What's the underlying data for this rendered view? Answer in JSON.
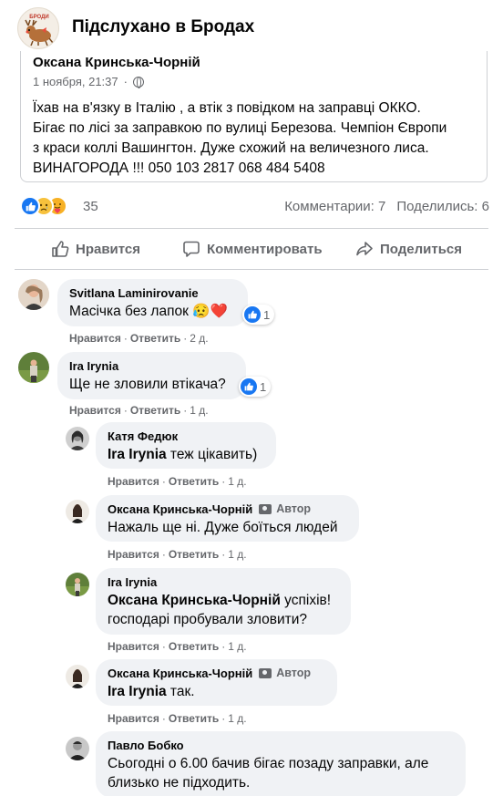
{
  "group": {
    "name": "Підслухано в Бродах",
    "logo_text": "БРОДИ"
  },
  "shared_post": {
    "author": "Оксана Кринська-Чорній",
    "date": "1 ноября, 21:37",
    "date_separator": "·",
    "text_lines": [
      "Їхав на в'язку в Італію , а втік з повідком на заправці ОККО.",
      "Бігає по лісі за заправкою по вулиці Березова. Чемпіон Європи",
      "з краси коллі Вашингтон. Дуже схожий на величезного лиса.",
      "ВИНАГОРОДА !!! 050 103 2817  068 484 5408"
    ]
  },
  "reactions": {
    "count": "35",
    "comments": "Комментарии: 7",
    "shares": "Поделились: 6",
    "icons": [
      "like-icon",
      "sad-icon",
      "care-icon"
    ]
  },
  "actions": {
    "like": "Нравится",
    "comment": "Комментировать",
    "share": "Поделиться"
  },
  "comment_actions": {
    "like": "Нравится",
    "reply": "Ответить",
    "separator": "·"
  },
  "comments": [
    {
      "name": "Svitlana Laminirovanie",
      "text": "Масічка без лапок 😥❤️",
      "time": "2 д.",
      "reactions": "1"
    },
    {
      "name": "Ira Irynia",
      "text": "Ще не зловили втікача?",
      "time": "1 д.",
      "reactions": "1"
    },
    {
      "name": "Катя Федюк",
      "tag": "Ira Irynia",
      "text": " теж цікавить)",
      "time": "1 д."
    },
    {
      "name": "Оксана Кринська-Чорній",
      "badge": "Автор",
      "text": "Нажаль ще ні. Дуже боїться людей",
      "time": "1 д."
    },
    {
      "name": "Ira Irynia",
      "tag": "Оксана Кринська-Чорній",
      "text": " успіхів!",
      "text2": "господарі пробували зловити?",
      "time": "1 д."
    },
    {
      "name": "Оксана Кринська-Чорній",
      "badge": "Автор",
      "tag": "Ira Irynia",
      "text": " так.",
      "time": "1 д."
    },
    {
      "name": "Павло Бобко",
      "text": "Сьогодні о 6.00 бачив бігає позаду заправки, але",
      "text2": "близько не підходить."
    }
  ],
  "colors": {
    "accent": "#1877f2",
    "secondary_text": "#65676b",
    "bubble_bg": "#f0f2f5",
    "divider": "#ced0d4"
  }
}
